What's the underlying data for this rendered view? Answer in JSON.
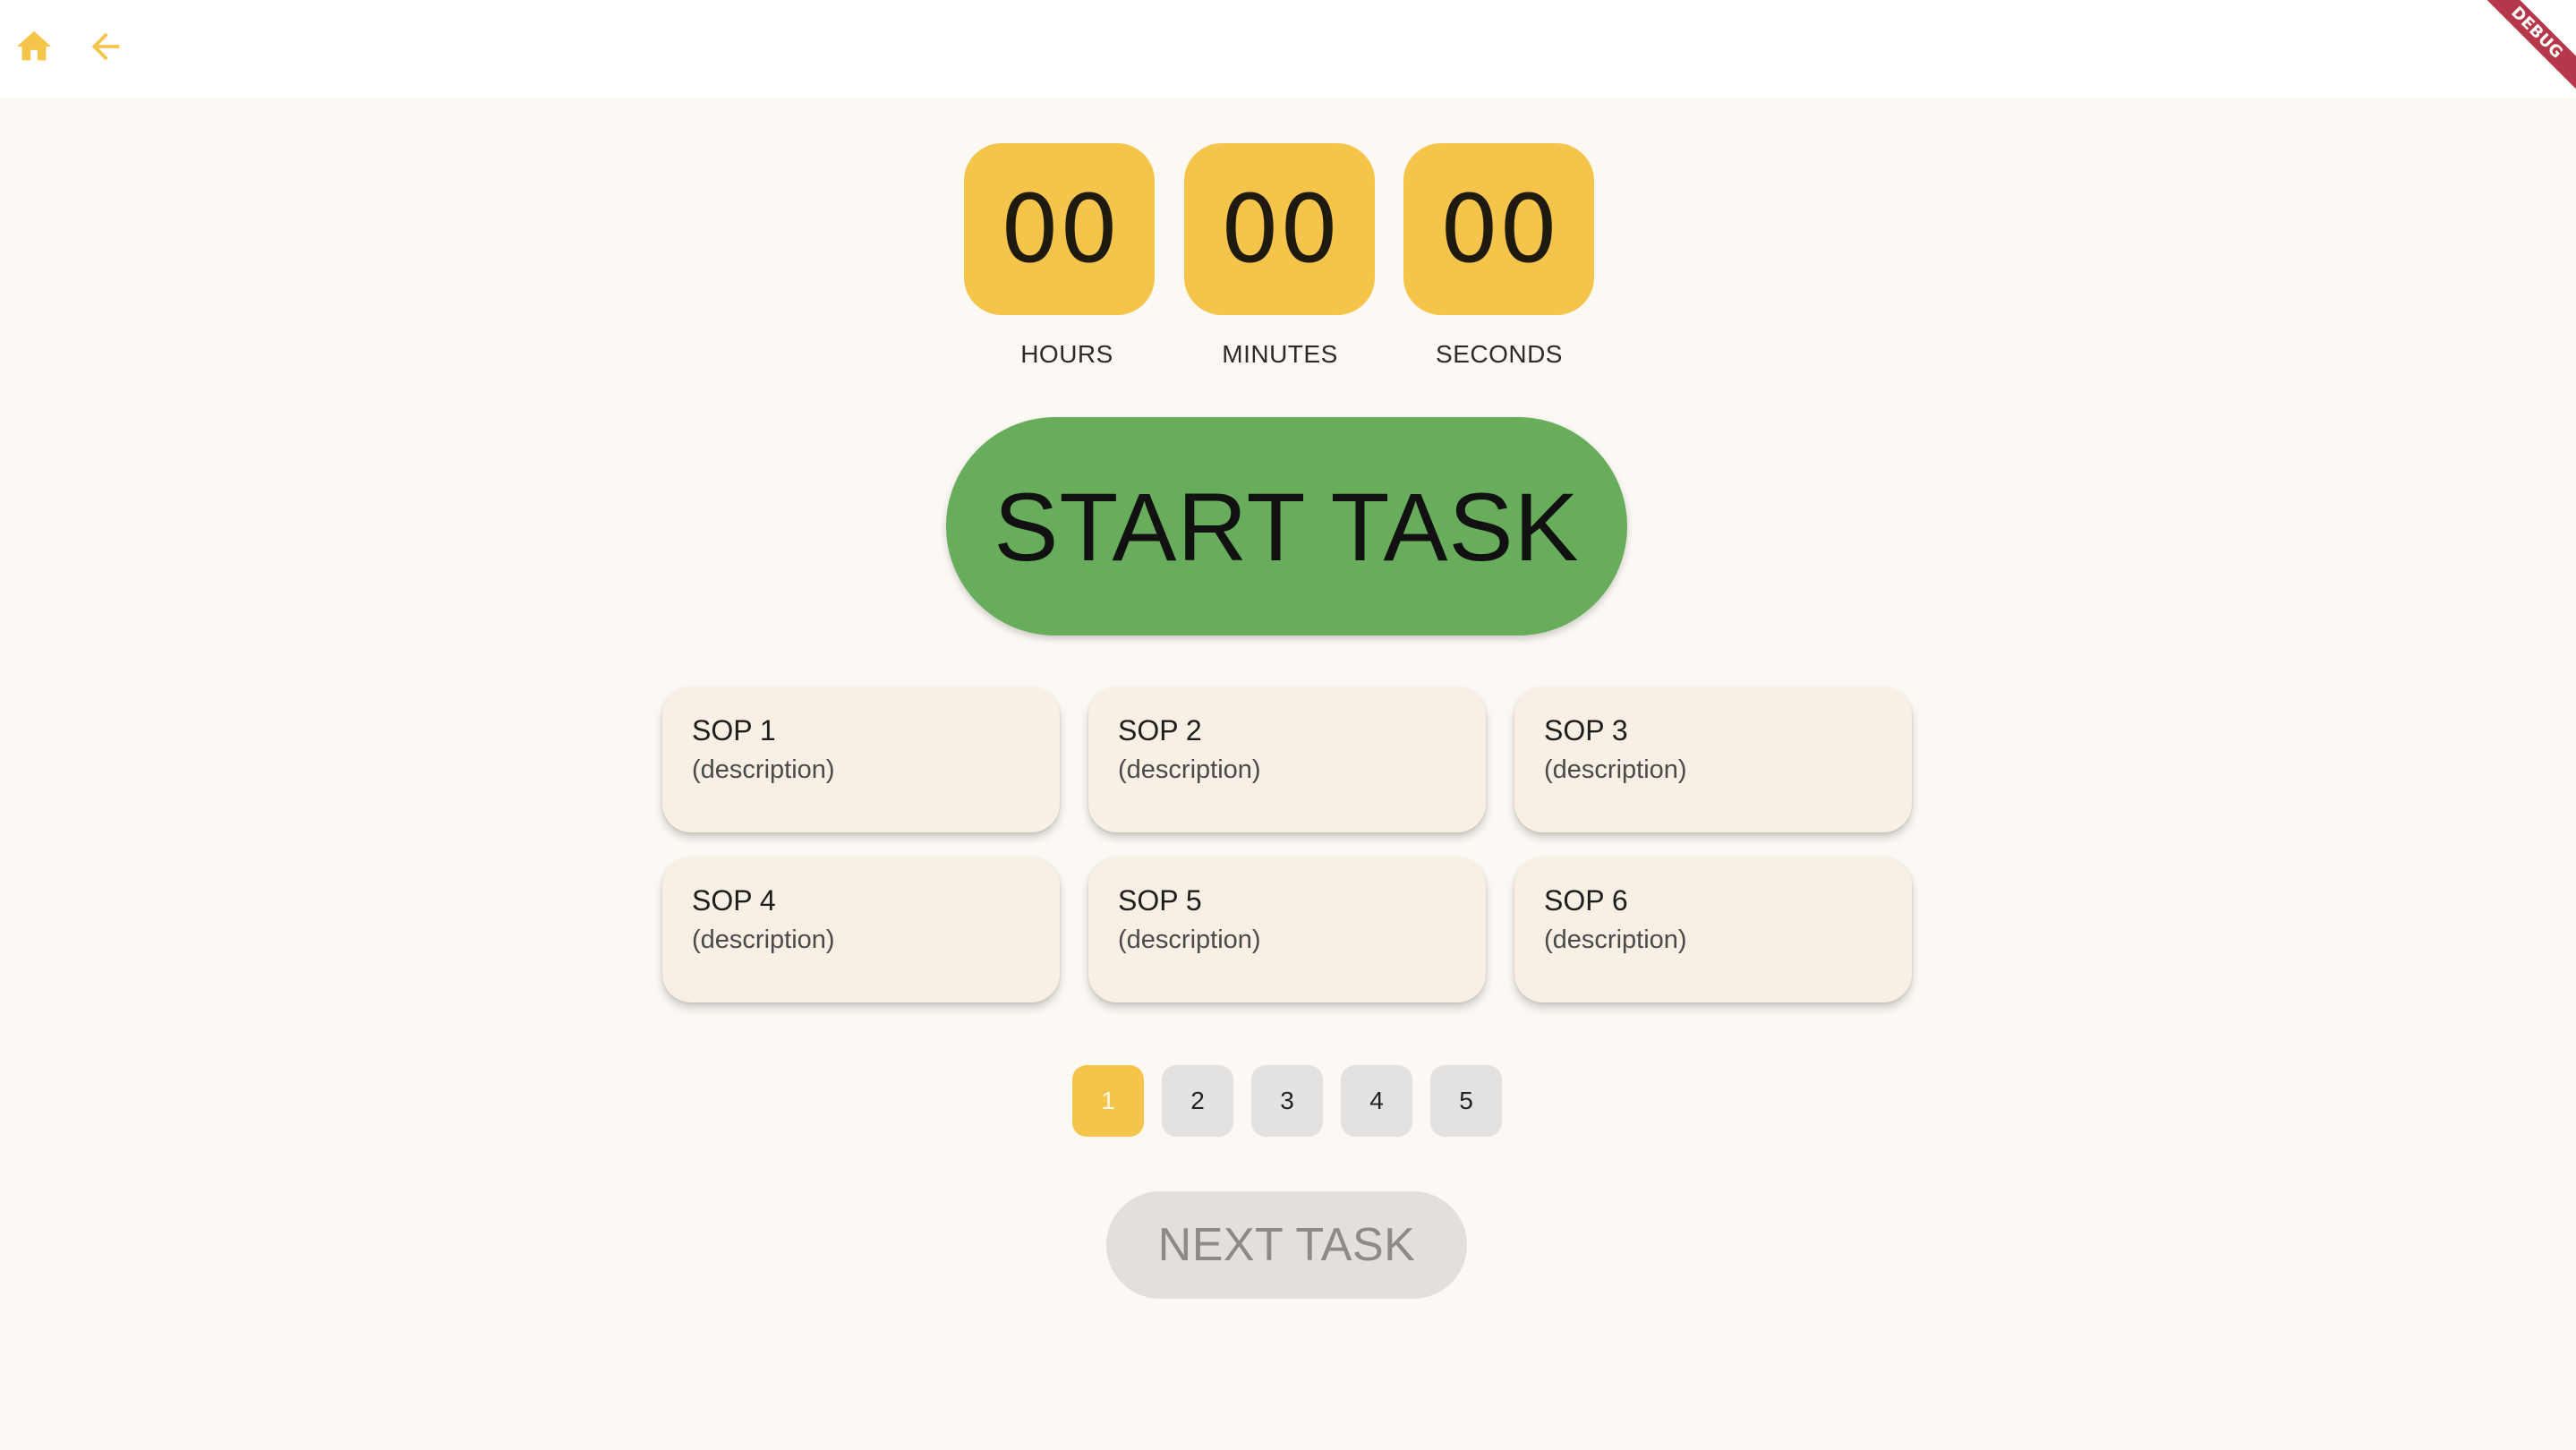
{
  "appbar": {
    "home_icon": "home-icon",
    "back_icon": "arrow-back-icon",
    "accent_color": "#f4c54a"
  },
  "debug_banner": "DEBUG",
  "timer": {
    "hours": "00",
    "minutes": "00",
    "seconds": "00",
    "hours_label": "HOURS",
    "minutes_label": "MINUTES",
    "seconds_label": "SECONDS"
  },
  "start_button": "START TASK",
  "sops": [
    {
      "title": "SOP 1",
      "description": "(description)"
    },
    {
      "title": "SOP 2",
      "description": "(description)"
    },
    {
      "title": "SOP 3",
      "description": "(description)"
    },
    {
      "title": "SOP 4",
      "description": "(description)"
    },
    {
      "title": "SOP 5",
      "description": "(description)"
    },
    {
      "title": "SOP 6",
      "description": "(description)"
    }
  ],
  "pagination": {
    "pages": [
      "1",
      "2",
      "3",
      "4",
      "5"
    ],
    "active": "1"
  },
  "next_button": "NEXT TASK",
  "colors": {
    "timer_bg": "#f4c54a",
    "start_bg": "#67ad5b",
    "card_bg": "#f8f0e4",
    "page_bg": "#fcf8f3",
    "disabled_bg": "#e3dfda"
  }
}
